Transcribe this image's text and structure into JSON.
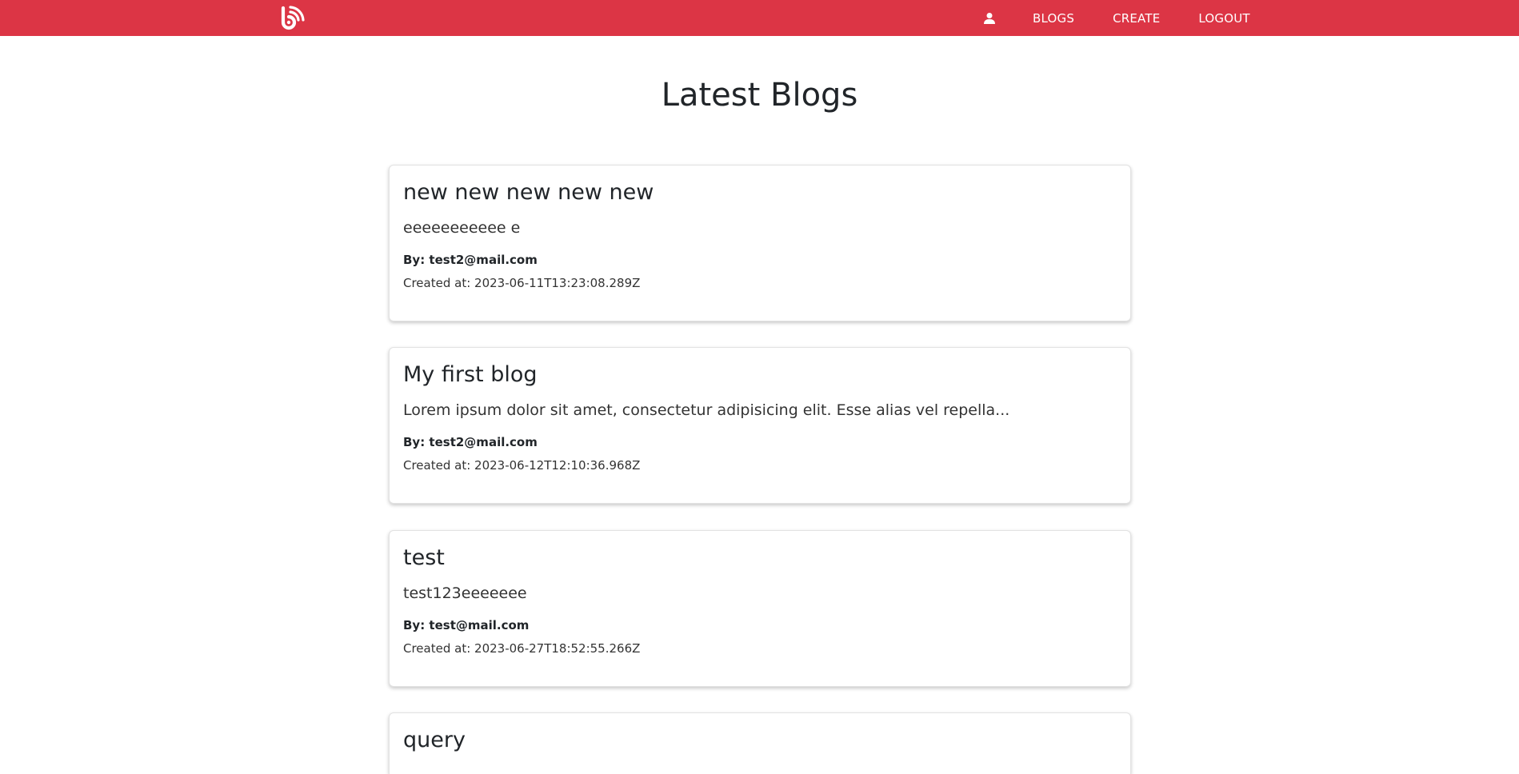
{
  "brand": {
    "color": "#dc3545",
    "logo_icon": "blog-feed-logo-icon"
  },
  "nav": {
    "user_icon": "user-icon",
    "blogs_label": "BLOGS",
    "create_label": "CREATE",
    "logout_label": "LOGOUT"
  },
  "page": {
    "title": "Latest Blogs"
  },
  "blogs": [
    {
      "title": "new new new new new",
      "excerpt": "eeeeeeeeeee e",
      "author": "By: test2@mail.com",
      "created": "Created at: 2023-06-11T13:23:08.289Z"
    },
    {
      "title": "My first blog",
      "excerpt": "Lorem ipsum dolor sit amet, consectetur adipisicing elit. Esse alias vel repella...",
      "author": "By: test2@mail.com",
      "created": "Created at: 2023-06-12T12:10:36.968Z"
    },
    {
      "title": "test",
      "excerpt": "test123eeeeeee",
      "author": "By: test@mail.com",
      "created": "Created at: 2023-06-27T18:52:55.266Z"
    },
    {
      "title": "query"
    }
  ]
}
